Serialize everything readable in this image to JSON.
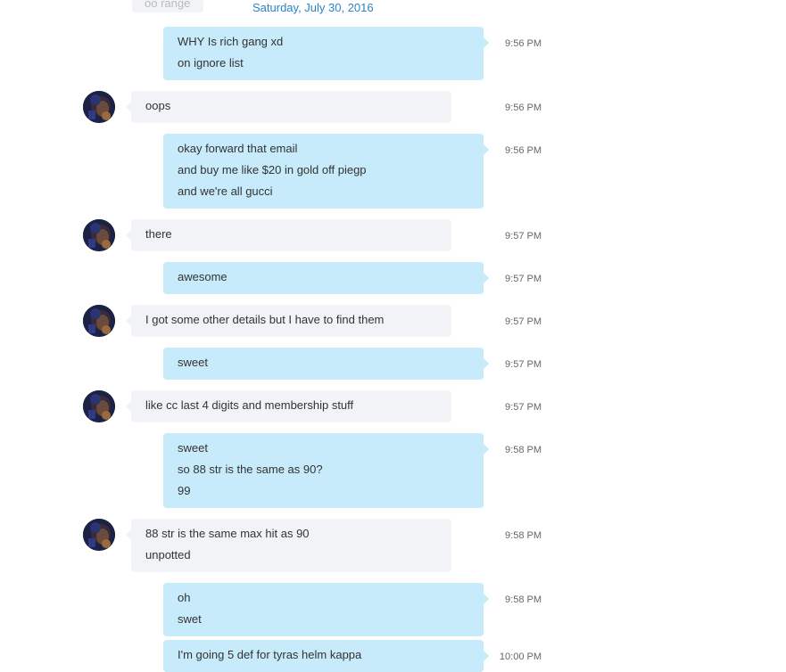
{
  "chat": {
    "faded_top_text": "oo range",
    "date_header": "Saturday, July 30, 2016",
    "messages": [
      {
        "dir": "out",
        "lines": [
          "WHY Is rich gang xd",
          "on ignore list"
        ],
        "time": "9:56 PM"
      },
      {
        "dir": "in",
        "lines": [
          "oops"
        ],
        "time": "9:56 PM"
      },
      {
        "dir": "out",
        "lines": [
          "okay forward that email",
          "and buy me like $20 in gold off piegp",
          "and we're all gucci"
        ],
        "time": "9:56 PM"
      },
      {
        "dir": "in",
        "lines": [
          "there"
        ],
        "time": "9:57 PM"
      },
      {
        "dir": "out",
        "lines": [
          "awesome"
        ],
        "time": "9:57 PM"
      },
      {
        "dir": "in",
        "lines": [
          "I got some other details but I have to find them"
        ],
        "time": "9:57 PM"
      },
      {
        "dir": "out",
        "lines": [
          "sweet"
        ],
        "time": "9:57 PM"
      },
      {
        "dir": "in",
        "lines": [
          "like cc last 4 digits and membership stuff"
        ],
        "time": "9:57 PM"
      },
      {
        "dir": "out",
        "lines": [
          "sweet",
          "so 88 str is the same as 90?",
          "99"
        ],
        "time": "9:58 PM"
      },
      {
        "dir": "in",
        "lines": [
          "88 str is the same max hit as 90",
          "unpotted"
        ],
        "time": "9:58 PM"
      },
      {
        "dir": "out",
        "lines": [
          "oh",
          "swet"
        ],
        "time": "9:58 PM"
      },
      {
        "dir": "out",
        "lines": [
          "I'm going 5 def for tyras helm kappa"
        ],
        "time": "10:00 PM"
      }
    ]
  }
}
